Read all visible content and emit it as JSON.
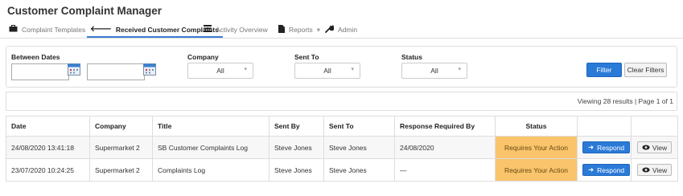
{
  "app": {
    "title": "Customer Complaint Manager"
  },
  "nav": {
    "items": [
      {
        "label": "Complaint Templates",
        "icon": "briefcase-icon"
      },
      {
        "label": "Received Customer Complaints",
        "icon": "arrow-left-icon"
      },
      {
        "label": "Activity Overview",
        "icon": "table-list-icon"
      },
      {
        "label": "Reports",
        "icon": "file-icon",
        "dropdown": "▾"
      },
      {
        "label": "Admin",
        "icon": "wrench-icon"
      }
    ]
  },
  "filters": {
    "between_dates_label": "Between Dates",
    "date_from": {
      "value": "",
      "placeholder": ""
    },
    "date_to": {
      "value": "",
      "placeholder": ""
    },
    "company_label": "Company",
    "company_value": "All",
    "sent_to_label": "Sent To",
    "sent_to_value": "All",
    "status_label": "Status",
    "status_value": "All",
    "filter_button": "Filter",
    "clear_button": "Clear Filters"
  },
  "results": {
    "summary": "Viewing 28 results | Page 1 of 1"
  },
  "table": {
    "headers": [
      "Date",
      "Company",
      "Title",
      "Sent By",
      "Sent To",
      "Response Required By",
      "Status",
      "",
      ""
    ],
    "rows": [
      {
        "date": "24/08/2020 13:41:18",
        "company": "Supermarket 2",
        "title": "SB Customer Complaints Log",
        "sent_by": "Steve Jones",
        "sent_to": "Steve Jones",
        "response_required_by": "24/08/2020",
        "status": "Requires Your Action",
        "respond_label": "Respond",
        "view_label": "View"
      },
      {
        "date": "23/07/2020 10:24:25",
        "company": "Supermarket 2",
        "title": "Complaints Log",
        "sent_by": "Steve Jones",
        "sent_to": "Steve Jones",
        "response_required_by": "—",
        "status": "Requires Your Action",
        "respond_label": "Respond",
        "view_label": "View"
      }
    ]
  },
  "colors": {
    "primary": "#2a7ad8",
    "status_highlight": "#f9c46b",
    "active_tab_underline": "#3a7bd5"
  }
}
